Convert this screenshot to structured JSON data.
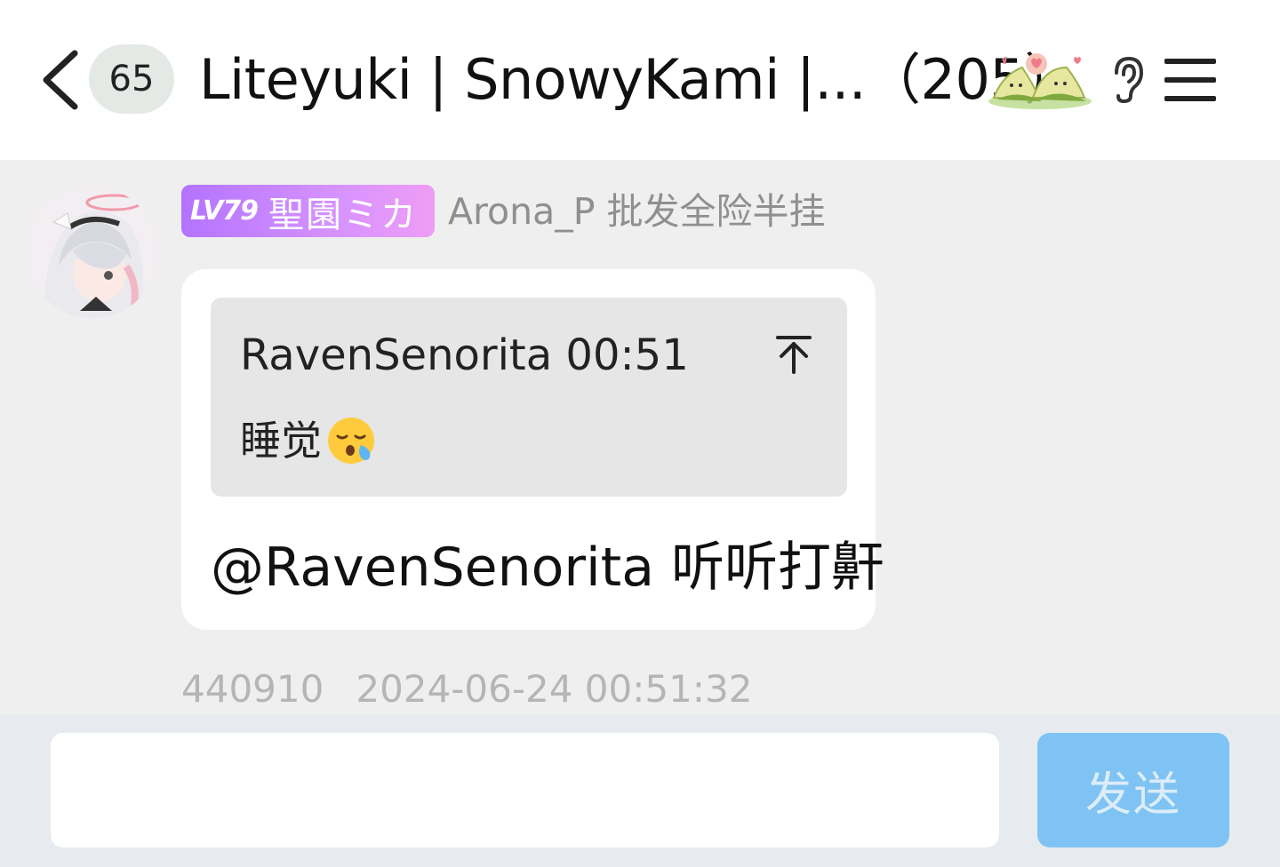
{
  "header": {
    "unread_count": "65",
    "title": "Liteyuki | SnowyKami |...（205）",
    "sticker_icon": "rice-dumpling-sticker",
    "ear_icon": "ear-icon",
    "menu_icon": "hamburger-menu-icon"
  },
  "message": {
    "level_label": "LV79",
    "level_nickname": "聖園ミカ",
    "username": "Arona_P 批发全险半挂",
    "quote": {
      "author_time": "RavenSenorita 00:51",
      "text": "睡觉",
      "emoji": "sleeping-face-emoji"
    },
    "text": "@RavenSenorita 听听打鼾",
    "message_id": "440910",
    "timestamp": "2024-06-24 00:51:32"
  },
  "composer": {
    "input_value": "",
    "send_label": "发送"
  },
  "colors": {
    "level_gradient_start": "#b473ff",
    "level_gradient_end": "#ef9df5",
    "send_button": "#7ec3f3",
    "header_bg": "#ffffff",
    "chat_bg": "#efefef"
  }
}
